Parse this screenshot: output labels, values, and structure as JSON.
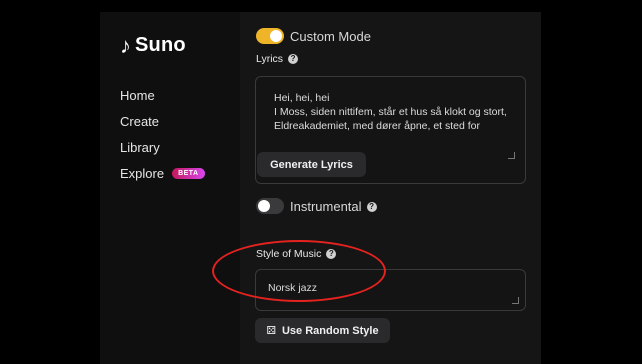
{
  "brand": {
    "name": "Suno",
    "glyph": "♪"
  },
  "nav": {
    "items": [
      {
        "label": "Home"
      },
      {
        "label": "Create"
      },
      {
        "label": "Library"
      },
      {
        "label": "Explore",
        "badge": "BETA"
      }
    ]
  },
  "create": {
    "custom_mode": {
      "label": "Custom Mode",
      "on": true
    },
    "lyrics": {
      "label": "Lyrics",
      "lines": [
        "Hei, hei, hei",
        "I Moss, siden nittifem, står et hus så klokt og stort,",
        "Eldreakademiet, med dører åpne, et sted for"
      ],
      "generate_label": "Generate Lyrics"
    },
    "instrumental": {
      "label": "Instrumental",
      "on": false
    },
    "style": {
      "label": "Style of Music",
      "value": "Norsk jazz",
      "random_label": "Use Random Style"
    }
  },
  "colors": {
    "toggle_on": "#f0b429",
    "annotation": "#e4231f"
  }
}
